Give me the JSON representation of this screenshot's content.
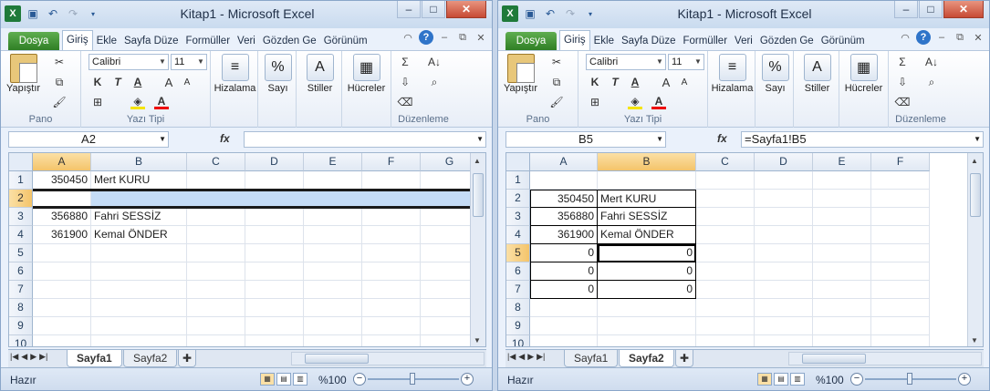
{
  "windows": [
    {
      "title": "Kitap1  -  Microsoft Excel",
      "tabs": [
        "Dosya",
        "Giriş",
        "Ekle",
        "Sayfa Düze",
        "Formüller",
        "Veri",
        "Gözden Ge",
        "Görünüm"
      ],
      "ribbon": {
        "paste": "Yapıştır",
        "clipboard": "Pano",
        "font_name": "Calibri",
        "font_size": "11",
        "font_group": "Yazı Tipi",
        "align": "Hizalama",
        "number": "Sayı",
        "styles": "Stiller",
        "cells": "Hücreler",
        "editing": "Düzenleme"
      },
      "name_box": "A2",
      "formula": "",
      "columns": [
        "A",
        "B",
        "C",
        "D",
        "E",
        "F",
        "G"
      ],
      "rows": [
        "1",
        "2",
        "3",
        "4",
        "5",
        "6",
        "7",
        "8",
        "9",
        "10"
      ],
      "data": [
        {
          "a": "350450",
          "b": "Mert KURU"
        },
        {
          "a": "",
          "b": ""
        },
        {
          "a": "356880",
          "b": "Fahri SESSİZ"
        },
        {
          "a": "361900",
          "b": "Kemal ÖNDER"
        }
      ],
      "sheets": [
        "Sayfa1",
        "Sayfa2"
      ],
      "active_sheet": "Sayfa1",
      "status": "Hazır",
      "zoom": "%100"
    },
    {
      "title": "Kitap1  -  Microsoft Excel",
      "tabs": [
        "Dosya",
        "Giriş",
        "Ekle",
        "Sayfa Düze",
        "Formüller",
        "Veri",
        "Gözden Ge",
        "Görünüm"
      ],
      "ribbon": {
        "paste": "Yapıştır",
        "clipboard": "Pano",
        "font_name": "Calibri",
        "font_size": "11",
        "font_group": "Yazı Tipi",
        "align": "Hizalama",
        "number": "Sayı",
        "styles": "Stiller",
        "cells": "Hücreler",
        "editing": "Düzenleme"
      },
      "name_box": "B5",
      "formula": "=Sayfa1!B5",
      "columns": [
        "A",
        "B",
        "C",
        "D",
        "E",
        "F"
      ],
      "rows": [
        "1",
        "2",
        "3",
        "4",
        "5",
        "6",
        "7",
        "8",
        "9",
        "10"
      ],
      "data": [
        {
          "a": "",
          "b": ""
        },
        {
          "a": "350450",
          "b": "Mert KURU"
        },
        {
          "a": "356880",
          "b": "Fahri SESSİZ"
        },
        {
          "a": "361900",
          "b": "Kemal ÖNDER"
        },
        {
          "a": "0",
          "b": "0"
        },
        {
          "a": "0",
          "b": "0"
        },
        {
          "a": "0",
          "b": "0"
        }
      ],
      "sheets": [
        "Sayfa1",
        "Sayfa2"
      ],
      "active_sheet": "Sayfa2",
      "status": "Hazır",
      "zoom": "%100"
    }
  ],
  "icons": [
    "excel-icon",
    "save-icon",
    "undo-icon",
    "redo-icon",
    "help-icon",
    "minimize-icon",
    "maximize-icon",
    "close-icon"
  ]
}
